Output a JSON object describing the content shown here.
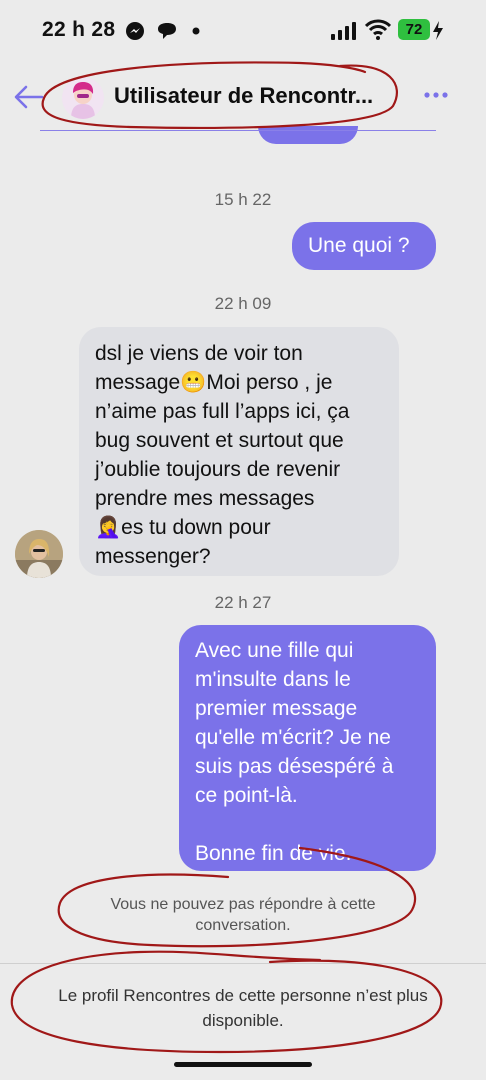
{
  "status_bar": {
    "time": "22 h 28",
    "battery": "72",
    "icons": [
      "messenger-icon",
      "chat-icon",
      "dot-icon",
      "signal-icon",
      "wifi-icon",
      "battery-icon",
      "charging-icon"
    ]
  },
  "header": {
    "title": "Utilisateur de Rencontr...",
    "back_icon": "back-arrow-icon",
    "more_icon": "more-horizontal-icon"
  },
  "messages": [
    {
      "timestamp": "15 h 22"
    },
    {
      "direction": "out",
      "lines": [
        "Une quoi ?"
      ]
    },
    {
      "timestamp": "22 h 09"
    },
    {
      "direction": "in",
      "lines": [
        "dsl je viens de voir ton",
        "message😬Moi perso , je",
        "n’aime pas full l’apps ici, ça",
        "bug souvent et surtout que",
        "j’oublie toujours de revenir",
        "prendre mes messages",
        "🤦‍♀️es tu down pour",
        "messenger?"
      ]
    },
    {
      "timestamp": "22 h 27"
    },
    {
      "direction": "out",
      "lines": [
        "Avec une fille qui",
        "m'insulte dans le",
        "premier message",
        "qu'elle m'écrit? Je ne",
        "suis pas désespéré à",
        "ce point-là.",
        "",
        "Bonne fin de vie."
      ]
    }
  ],
  "notice": {
    "line1": "Vous ne pouvez pas répondre à cette",
    "line2": "conversation."
  },
  "footer": {
    "line1": "Le profil Rencontres de cette personne n’est plus",
    "line2": "disponible."
  },
  "colors": {
    "accent": "#7b72e9",
    "incoming_bubble": "#dfe0e4",
    "background": "#ebebeb",
    "annotation_ink": "#a01818"
  }
}
